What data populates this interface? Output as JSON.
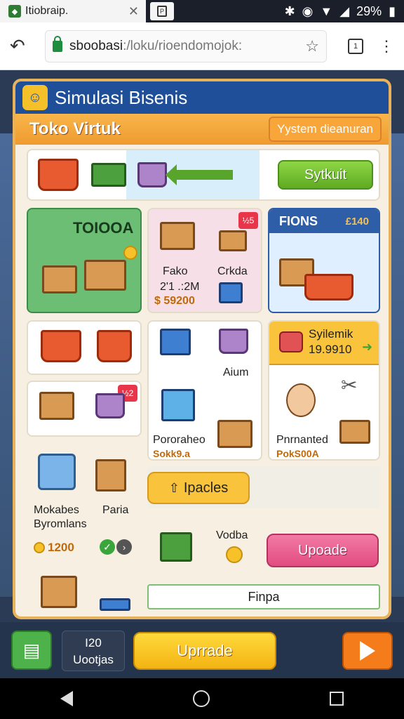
{
  "browser": {
    "tab_title": "Itiobraip.",
    "url_host": "sboobasi",
    "url_path": ":/loku/rioendomojok:",
    "battery": "29%"
  },
  "app": {
    "title": "Simulasi Bisenis",
    "subtitle": "Toko Virtuk",
    "status_button": "Yystem dieanuran",
    "top_action": "Sytkuit"
  },
  "cards": {
    "store": {
      "label": "TOIOOA"
    },
    "products": {
      "name1": "Fako",
      "name2": "Crkda",
      "stock": "2'1 .:2M",
      "price": "$ 59200",
      "badge": "½5"
    },
    "fions": {
      "title": "FIONS",
      "value": "£140"
    },
    "banner": {
      "line1": "Syilemik",
      "line2": "19.9910"
    },
    "goods": {
      "label1": "Aium",
      "label2": "Pororaheo",
      "price2": "Sokk9.a"
    },
    "promo": {
      "label": "Pnrnanted",
      "price": "PokS00A"
    },
    "badge2": "½2",
    "bottom_left": {
      "name1": "Mokabes",
      "name2": "Byromlans",
      "name3": "Paria",
      "price": "1200"
    }
  },
  "upgrades": {
    "tab_label": "Ipacles",
    "item_label": "Vodba",
    "upgrade_button": "Upoade",
    "footer_label": "Finpa"
  },
  "toolbar": {
    "level_line1": "I20",
    "level_line2": "Uootjas",
    "upgrade": "Uprrade"
  },
  "colors": {
    "header": "#1f4f98",
    "accent_orange": "#f8b64a",
    "accent_green": "#5faa22",
    "accent_pink": "#e24c80",
    "accent_yellow": "#f9c33b"
  }
}
